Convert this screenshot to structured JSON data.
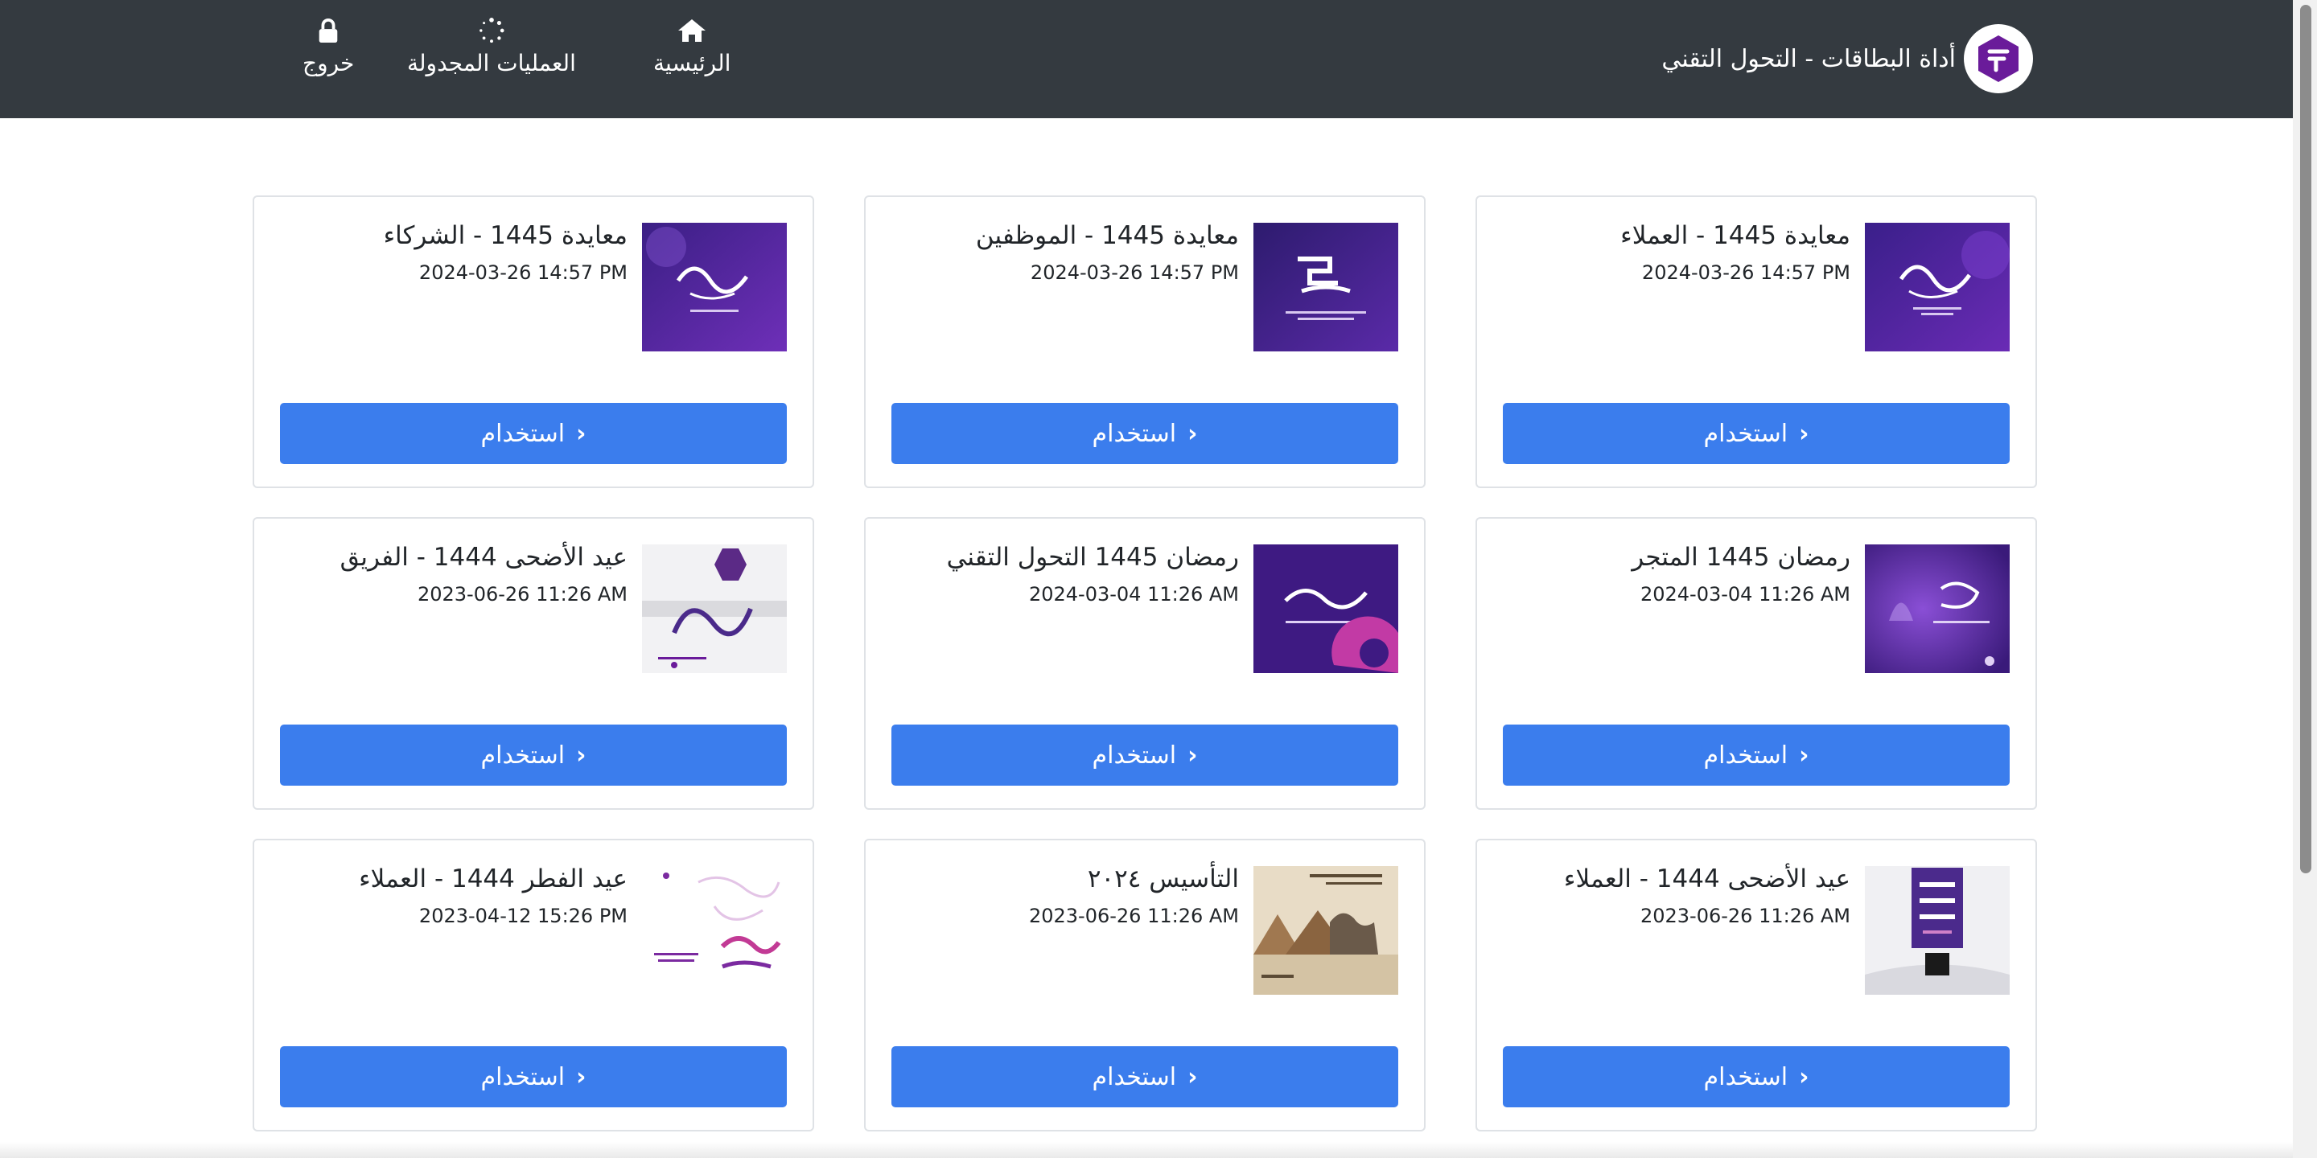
{
  "header": {
    "app_title": "أداة البطاقات - التحول التقني",
    "nav": {
      "home": "الرئيسية",
      "scheduled": "العمليات المجدولة",
      "logout": "خروج"
    }
  },
  "colors": {
    "navbar": "#343a40",
    "accent": "#3b7ded",
    "brand_purple": "#6a1b9a"
  },
  "icons": {
    "home": "home-icon",
    "scheduled": "spinner-icon",
    "logout": "lock-icon",
    "use": "chevron-left-icon"
  },
  "use_label": "استخدام",
  "cards": [
    {
      "title": "معايدة 1445 - العملاء",
      "date": "2024-03-26 14:57 PM"
    },
    {
      "title": "معايدة 1445 - الموظفين",
      "date": "2024-03-26 14:57 PM"
    },
    {
      "title": "معايدة 1445 - الشركاء",
      "date": "2024-03-26 14:57 PM"
    },
    {
      "title": "رمضان 1445 المتجر",
      "date": "2024-03-04 11:26 AM"
    },
    {
      "title": "رمضان 1445 التحول التقني",
      "date": "2024-03-04 11:26 AM"
    },
    {
      "title": "عيد الأضحى 1444 - الفريق",
      "date": "2023-06-26 11:26 AM"
    },
    {
      "title": "عيد الأضحى 1444 - العملاء",
      "date": "2023-06-26 11:26 AM"
    },
    {
      "title": "التأسيس ٢٠٢٤",
      "date": "2023-06-26 11:26 AM"
    },
    {
      "title": "عيد الفطر 1444 - العملاء",
      "date": "2023-04-12 15:26 PM"
    }
  ]
}
